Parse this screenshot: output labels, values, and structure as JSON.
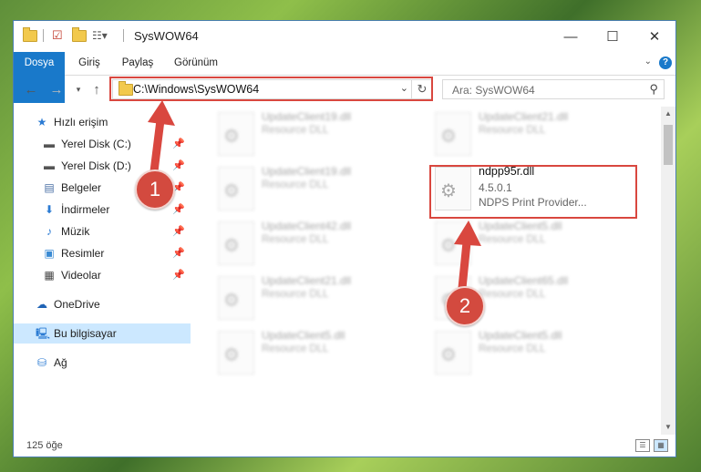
{
  "window": {
    "title": "SysWOW64",
    "controls": {
      "minimize": "—",
      "maximize": "☐",
      "close": "✕"
    }
  },
  "ribbon": {
    "tabs": [
      "Dosya",
      "Giriş",
      "Paylaş",
      "Görünüm"
    ],
    "help": "?"
  },
  "navbar": {
    "address": "C:\\Windows\\SysWOW64",
    "search_placeholder": "Ara: SysWOW64"
  },
  "sidebar": {
    "items": [
      {
        "label": "Hızlı erişim",
        "icon": "star-icon",
        "pinned": false
      },
      {
        "label": "Yerel Disk (C:)",
        "icon": "drive-icon",
        "pinned": true
      },
      {
        "label": "Yerel Disk (D:)",
        "icon": "drive-icon",
        "pinned": true
      },
      {
        "label": "Belgeler",
        "icon": "documents-icon",
        "pinned": true
      },
      {
        "label": "İndirmeler",
        "icon": "download-icon",
        "pinned": true
      },
      {
        "label": "Müzik",
        "icon": "music-icon",
        "pinned": true
      },
      {
        "label": "Resimler",
        "icon": "pictures-icon",
        "pinned": true
      },
      {
        "label": "Videolar",
        "icon": "videos-icon",
        "pinned": true
      },
      {
        "label": "OneDrive",
        "icon": "cloud-icon",
        "pinned": false
      },
      {
        "label": "Bu bilgisayar",
        "icon": "computer-icon",
        "pinned": false,
        "selected": true
      },
      {
        "label": "Ağ",
        "icon": "network-icon",
        "pinned": false
      }
    ],
    "pin_glyph": "📌"
  },
  "files": [
    {
      "name": "UpdateClient19.dll",
      "desc": "Resource DLL"
    },
    {
      "name": "UpdateClient21.dll",
      "desc": "Resource DLL"
    },
    {
      "name": "UpdateClient19.dll",
      "desc": "Resource DLL"
    },
    {
      "name": "ndpp95r.dll",
      "version": "4.5.0.1",
      "desc": "NDPS Print Provider...",
      "highlighted": true
    },
    {
      "name": "UpdateClient42.dll",
      "desc": "Resource DLL"
    },
    {
      "name": "UpdateClient5.dll",
      "desc": "Resource DLL"
    },
    {
      "name": "UpdateClient21.dll",
      "desc": "Resource DLL"
    },
    {
      "name": "UpdateClient65.dll",
      "desc": "Resource DLL"
    },
    {
      "name": "UpdateClient5.dll",
      "desc": "Resource DLL"
    },
    {
      "name": "UpdateClient5.dll",
      "desc": "Resource DLL"
    }
  ],
  "status": {
    "count": "125 öğe"
  },
  "annotations": {
    "step1": "1",
    "step2": "2",
    "color": "#d9473f"
  }
}
